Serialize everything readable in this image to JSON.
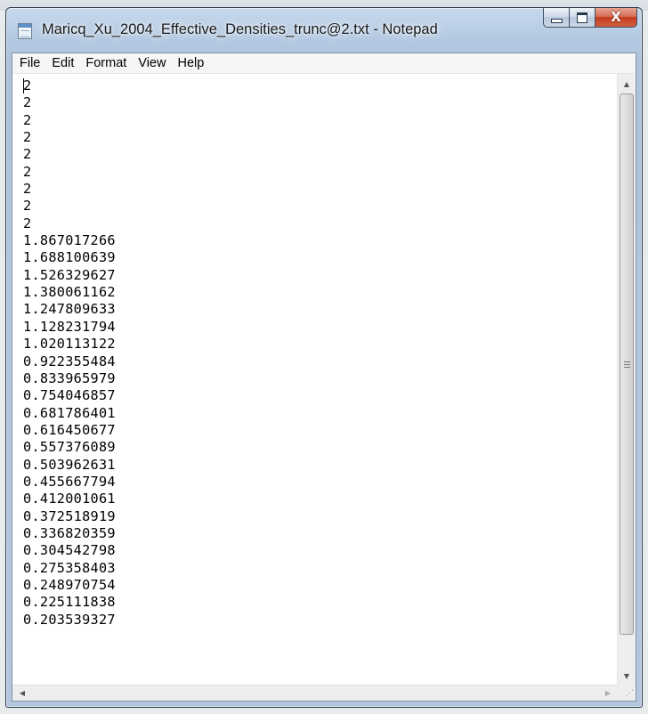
{
  "window": {
    "title": "Maricq_Xu_2004_Effective_Densities_trunc@2.txt - Notepad",
    "icon": "notepad-icon",
    "controls": {
      "minimize_icon": "minimize-icon",
      "maximize_icon": "maximize-icon",
      "close_icon": "close-icon",
      "close_glyph": "X"
    }
  },
  "menu": {
    "file": "File",
    "edit": "Edit",
    "format": "Format",
    "view": "View",
    "help": "Help"
  },
  "document": {
    "lines": [
      "2",
      "2",
      "2",
      "2",
      "2",
      "2",
      "2",
      "2",
      "2",
      "1.867017266",
      "1.688100639",
      "1.526329627",
      "1.380061162",
      "1.247809633",
      "1.128231794",
      "1.020113122",
      "0.922355484",
      "0.833965979",
      "0.754046857",
      "0.681786401",
      "0.616450677",
      "0.557376089",
      "0.503962631",
      "0.455667794",
      "0.412001061",
      "0.372518919",
      "0.336820359",
      "0.304542798",
      "0.275358403",
      "0.248970754",
      "0.225111838",
      "0.203539327"
    ]
  },
  "scrollbars": {
    "up_glyph": "▲",
    "down_glyph": "▼",
    "left_glyph": "◀",
    "right_glyph": "▶",
    "size_grip_glyph": "⋰"
  },
  "colors": {
    "title_bar": "#b6cbe3",
    "close_button": "#c43c1e",
    "editor_background": "#ffffff"
  }
}
